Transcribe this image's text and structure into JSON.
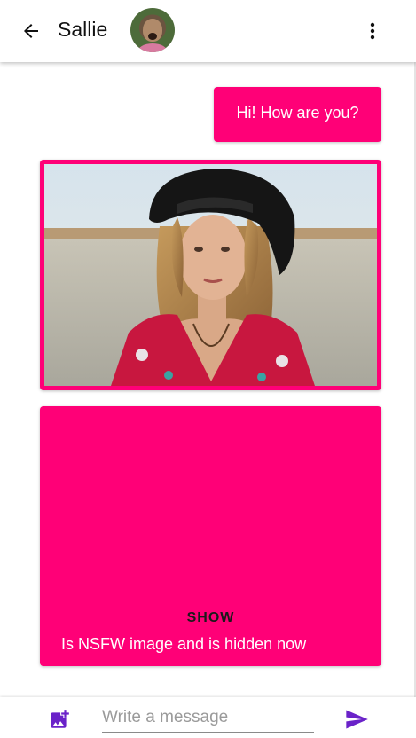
{
  "header": {
    "back_icon": "arrow-back-icon",
    "title": "Sallie",
    "menu_icon": "more-vert-icon"
  },
  "messages": [
    {
      "type": "text",
      "text": "Hi! How are you?"
    },
    {
      "type": "image"
    },
    {
      "type": "hidden-image",
      "show_label": "SHOW",
      "note": "Is NSFW image and is hidden now"
    }
  ],
  "composer": {
    "attach_icon": "add-photo-icon",
    "placeholder": "Write a message",
    "value": "",
    "send_icon": "send-icon"
  },
  "colors": {
    "accent": "#ff0077",
    "icon_purple": "#6a22c9",
    "bar_bg": "#ffffff"
  }
}
